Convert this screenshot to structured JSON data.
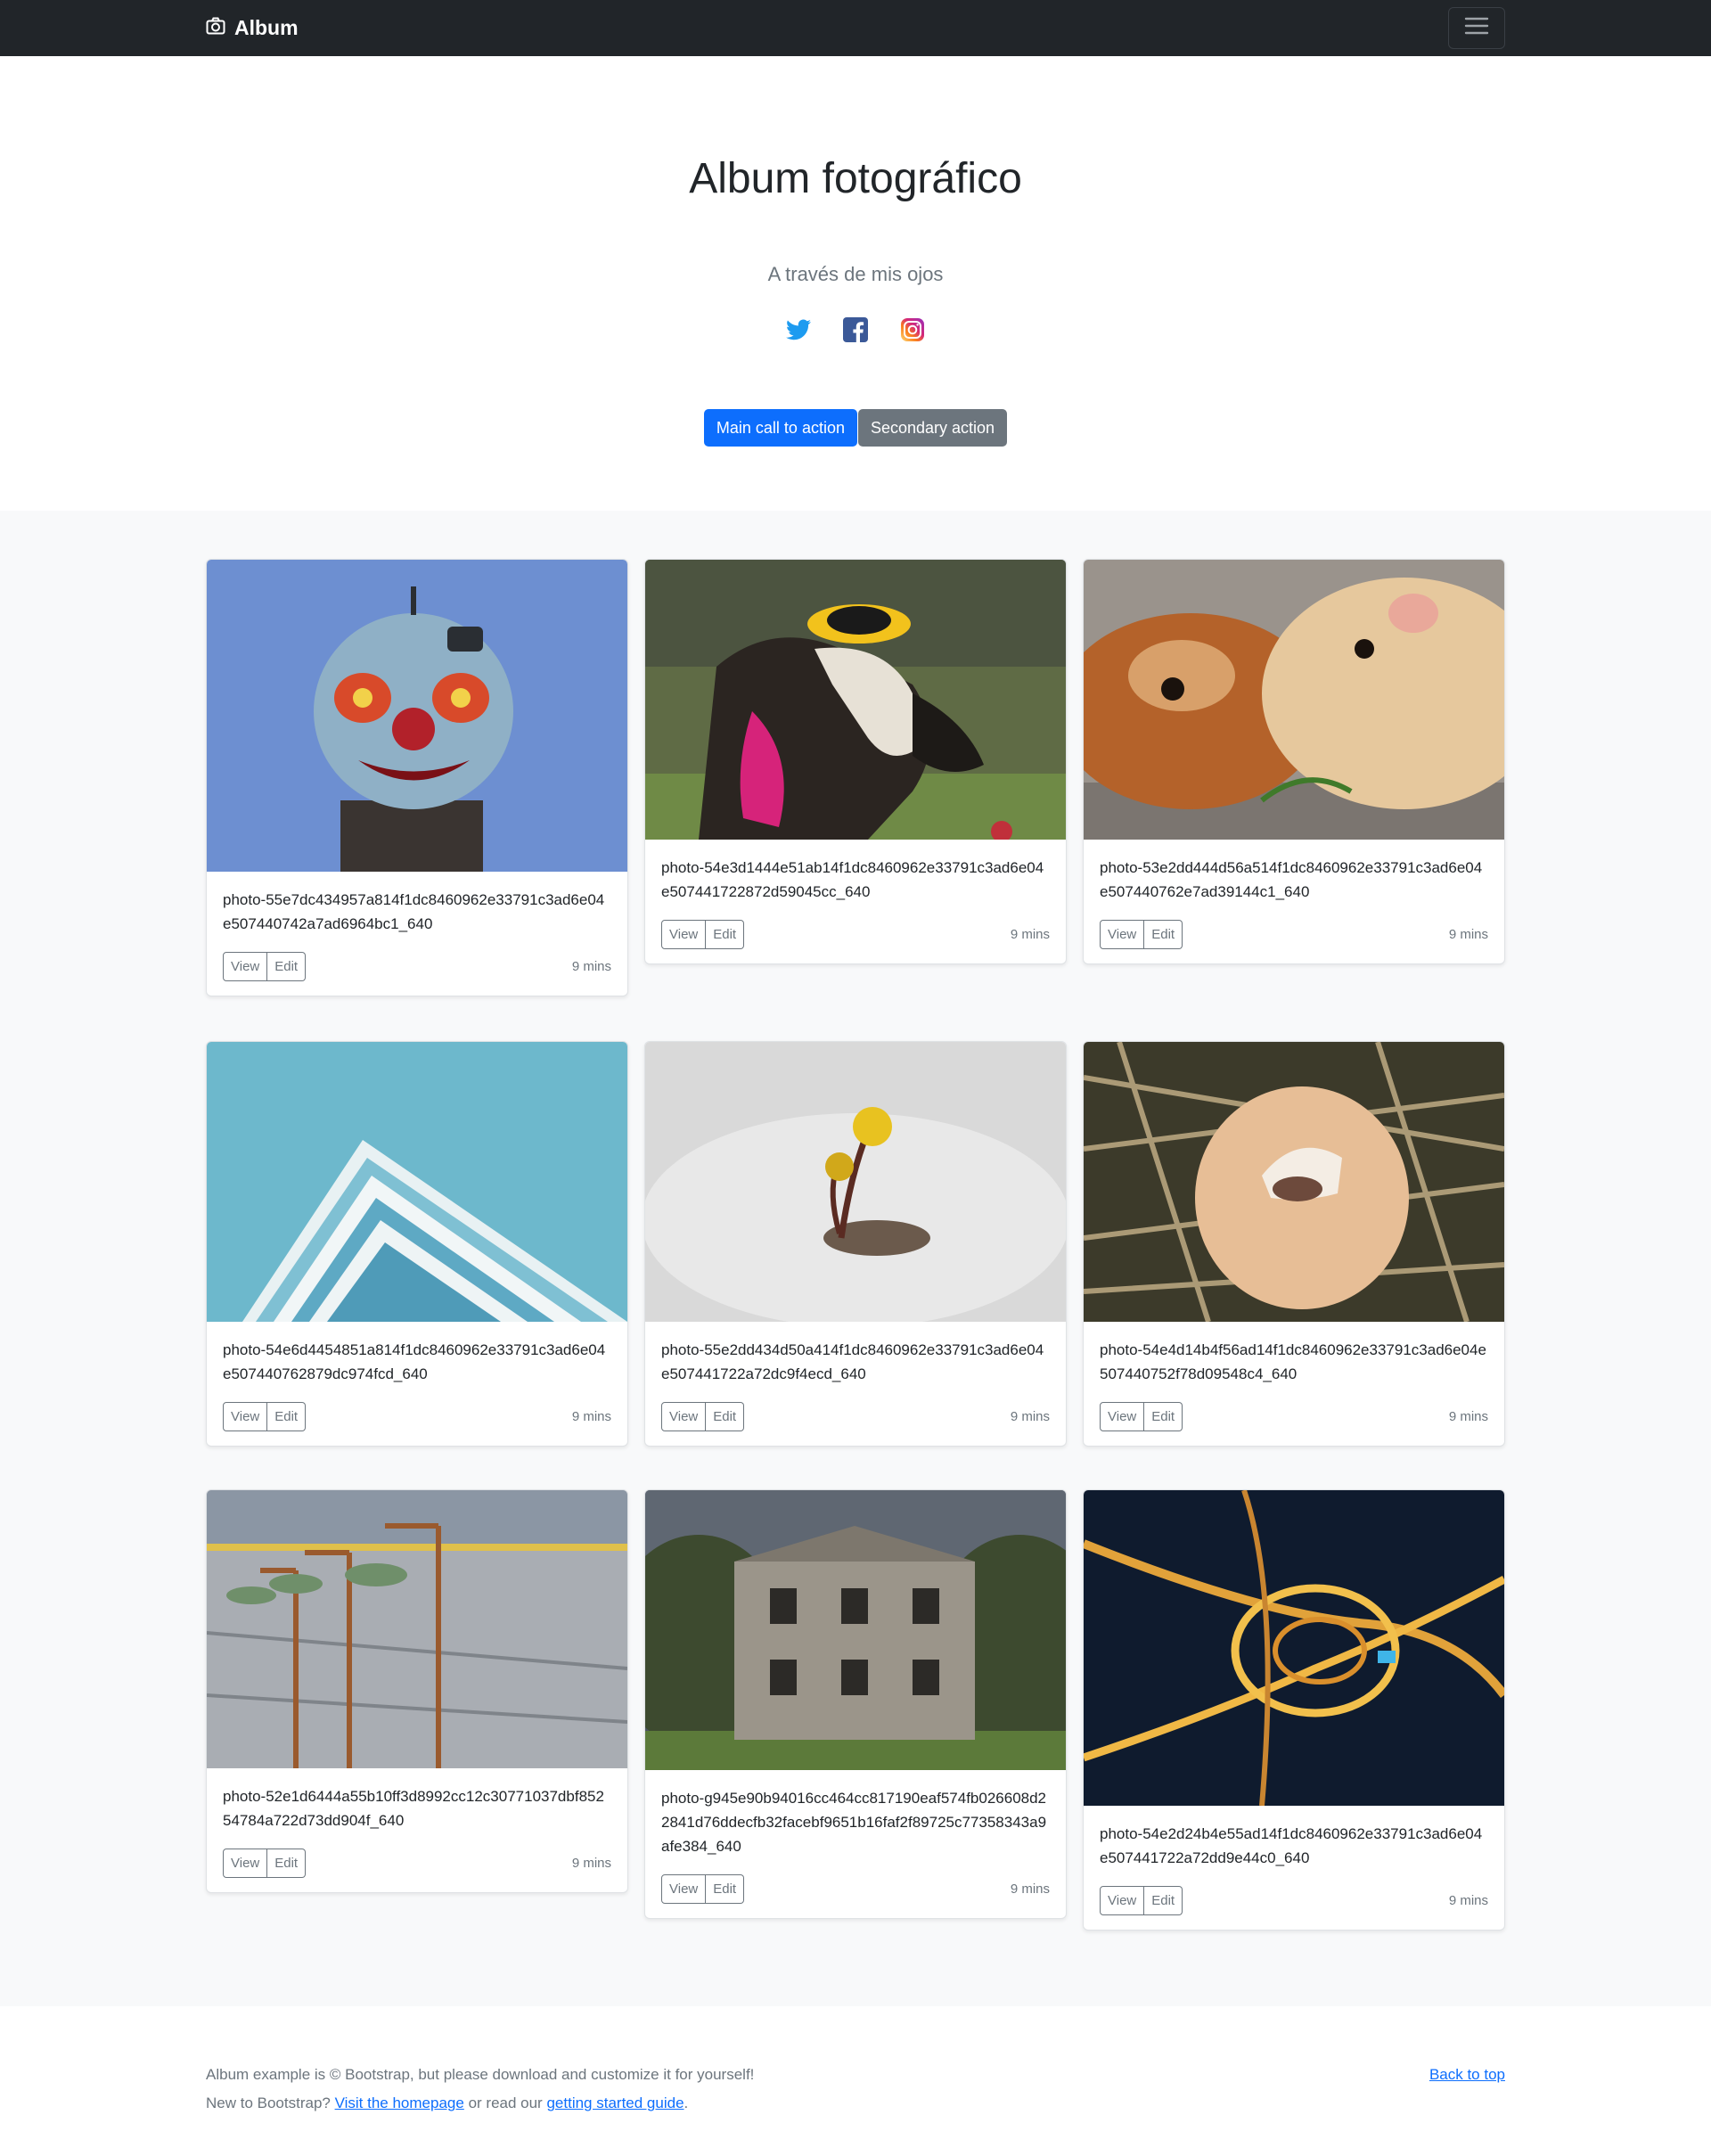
{
  "navbar": {
    "brand": "Album",
    "brand_icon": "camera-icon",
    "toggler_icon": "hamburger-icon"
  },
  "hero": {
    "title": "Album fotográfico",
    "subtitle": "A través de mis ojos",
    "social": [
      "twitter-icon",
      "facebook-icon",
      "instagram-icon"
    ],
    "primary_label": "Main call to action",
    "secondary_label": "Secondary action"
  },
  "cards": [
    {
      "text": "photo-55e7dc434957a814f1dc8460962e33791c3ad6e04e507440742a7ad6964bc1_640",
      "time": "9 mins",
      "image": "clown-face-sculpture"
    },
    {
      "text": "photo-54e3d1444e51ab14f1dc8460962e33791c3ad6e04e507441722872d59045cc_640",
      "time": "9 mins",
      "image": "goat-with-sombrero"
    },
    {
      "text": "photo-53e2dd444d56a514f1dc8460962e33791c3ad6e04e507440762e7ad39144c1_640",
      "time": "9 mins",
      "image": "guinea-pigs"
    },
    {
      "text": "photo-54e6d4454851a814f1dc8460962e33791c3ad6e04e507440762879dc974fcd_640",
      "time": "9 mins",
      "image": "building-facade"
    },
    {
      "text": "photo-55e2dd434d50a414f1dc8460962e33791c3ad6e04e507441722a72dc9f4ecd_640",
      "time": "9 mins",
      "image": "flower-in-snow"
    },
    {
      "text": "photo-54e4d14b4f56ad14f1dc8460962e33791c3ad6e04e507440752f78d09548c4_640",
      "time": "9 mins",
      "image": "hatching-egg"
    },
    {
      "text": "photo-52e1d6444a55b10ff3d8992cc12c30771037dbf85254784a722d73dd904f_640",
      "time": "9 mins",
      "image": "shower-heads-wall"
    },
    {
      "text": "photo-g945e90b94016cc464cc817190eaf574fb026608d22841d76ddecfb32facebf9651b16faf2f89725c77358343a9afe384_640",
      "time": "9 mins",
      "image": "old-mansion"
    },
    {
      "text": "photo-54e2d24b4e55ad14f1dc8460962e33791c3ad6e04e507441722a72dd9e44c0_640",
      "time": "9 mins",
      "image": "highway-night-aerial"
    }
  ],
  "card_buttons": {
    "view": "View",
    "edit": "Edit"
  },
  "footer": {
    "line1": "Album example is © Bootstrap, but please download and customize it for yourself!",
    "line2_prefix": "New to Bootstrap?",
    "line2_link1": "Visit the homepage",
    "line2_middle": "or read our",
    "line2_link2": "getting started guide",
    "line2_suffix": ".",
    "back_to_top": "Back to top"
  },
  "colors": {
    "navbar": "#212529",
    "primary": "#0d6efd",
    "secondary": "#6c757d",
    "album_bg": "#f8f9fa"
  }
}
